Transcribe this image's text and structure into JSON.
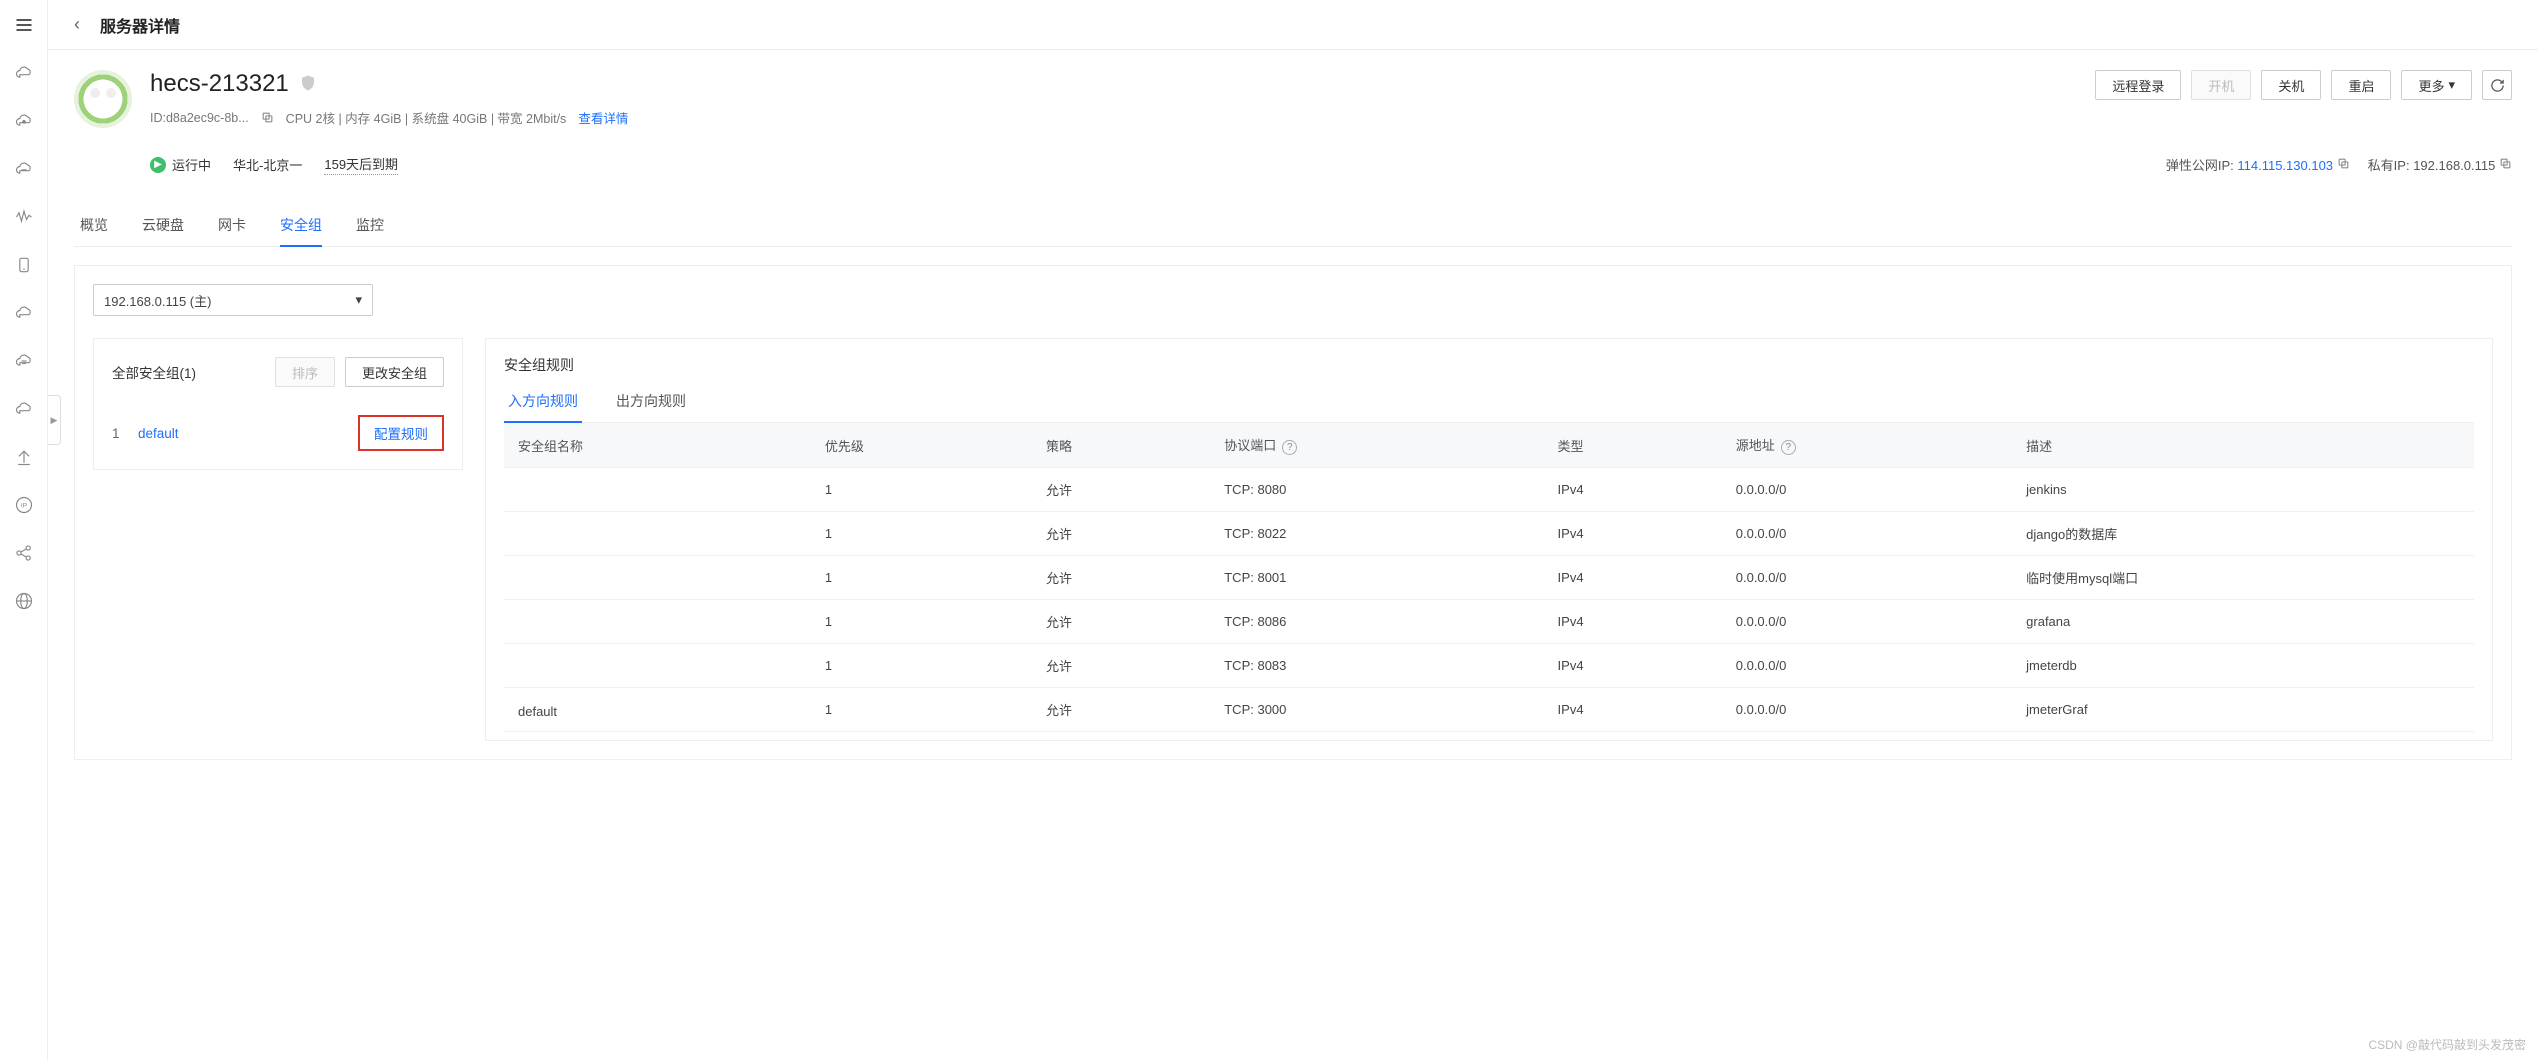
{
  "page_title": "服务器详情",
  "server": {
    "name": "hecs-213321",
    "id_label": "ID:d8a2ec9c-8b...",
    "spec": "CPU 2核 | 内存 4GiB | 系统盘 40GiB | 带宽 2Mbit/s",
    "view_details": "查看详情",
    "status": "运行中",
    "region": "华北-北京一",
    "expiry": "159天后到期",
    "eip_label": "弹性公网IP:",
    "eip": "114.115.130.103",
    "private_label": "私有IP:",
    "private_ip": "192.168.0.115"
  },
  "actions": {
    "remote": "远程登录",
    "power_on": "开机",
    "power_off": "关机",
    "reboot": "重启",
    "more": "更多"
  },
  "tabs": [
    "概览",
    "云硬盘",
    "网卡",
    "安全组",
    "监控"
  ],
  "active_tab": 3,
  "ip_select": "192.168.0.115 (主)",
  "left_card": {
    "title": "全部安全组(1)",
    "sort_btn": "排序",
    "change_btn": "更改安全组",
    "groups": [
      {
        "idx": "1",
        "name": "default",
        "config": "配置规则"
      }
    ]
  },
  "right_card": {
    "title": "安全组规则",
    "sub_tabs": [
      "入方向规则",
      "出方向规则"
    ],
    "active_sub": 0,
    "columns": [
      "安全组名称",
      "优先级",
      "策略",
      "协议端口",
      "类型",
      "源地址",
      "描述"
    ],
    "group_name": "default",
    "rows": [
      {
        "priority": "1",
        "policy": "允许",
        "port": "TCP: 8080",
        "type": "IPv4",
        "src": "0.0.0.0/0",
        "desc": "jenkins"
      },
      {
        "priority": "1",
        "policy": "允许",
        "port": "TCP: 8022",
        "type": "IPv4",
        "src": "0.0.0.0/0",
        "desc": "django的数据库"
      },
      {
        "priority": "1",
        "policy": "允许",
        "port": "TCP: 8001",
        "type": "IPv4",
        "src": "0.0.0.0/0",
        "desc": "临时使用mysql端口"
      },
      {
        "priority": "1",
        "policy": "允许",
        "port": "TCP: 8086",
        "type": "IPv4",
        "src": "0.0.0.0/0",
        "desc": "grafana"
      },
      {
        "priority": "1",
        "policy": "允许",
        "port": "TCP: 8083",
        "type": "IPv4",
        "src": "0.0.0.0/0",
        "desc": "jmeterdb"
      },
      {
        "priority": "1",
        "policy": "允许",
        "port": "TCP: 3000",
        "type": "IPv4",
        "src": "0.0.0.0/0",
        "desc": "jmeterGraf"
      }
    ]
  },
  "watermark": "CSDN @敲代码敲到头发茂密"
}
